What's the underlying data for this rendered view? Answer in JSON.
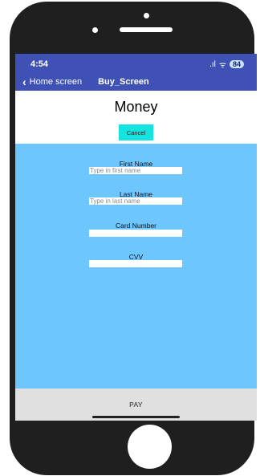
{
  "status_bar": {
    "time": "4:54",
    "signal": ".ıl",
    "wifi": "ᯤ",
    "battery": "84"
  },
  "nav": {
    "back_label": "Home screen",
    "title": "Buy_Screen"
  },
  "header": {
    "title": "Money",
    "cancel_label": "Cancel"
  },
  "form": {
    "first_name": {
      "label": "First Name",
      "placeholder": "Type in first name",
      "value": ""
    },
    "last_name": {
      "label": "Last Name",
      "placeholder": "Type in last name",
      "value": ""
    },
    "card_number": {
      "label": "Card Number",
      "placeholder": "",
      "value": ""
    },
    "cvv": {
      "label": "CVV",
      "placeholder": "",
      "value": ""
    }
  },
  "footer": {
    "pay_label": "PAY"
  },
  "colors": {
    "nav_bg": "#3f51b5",
    "cancel_bg": "#14e3e0",
    "form_bg": "#6ec6ff",
    "pay_bg": "#e0e0e0"
  }
}
